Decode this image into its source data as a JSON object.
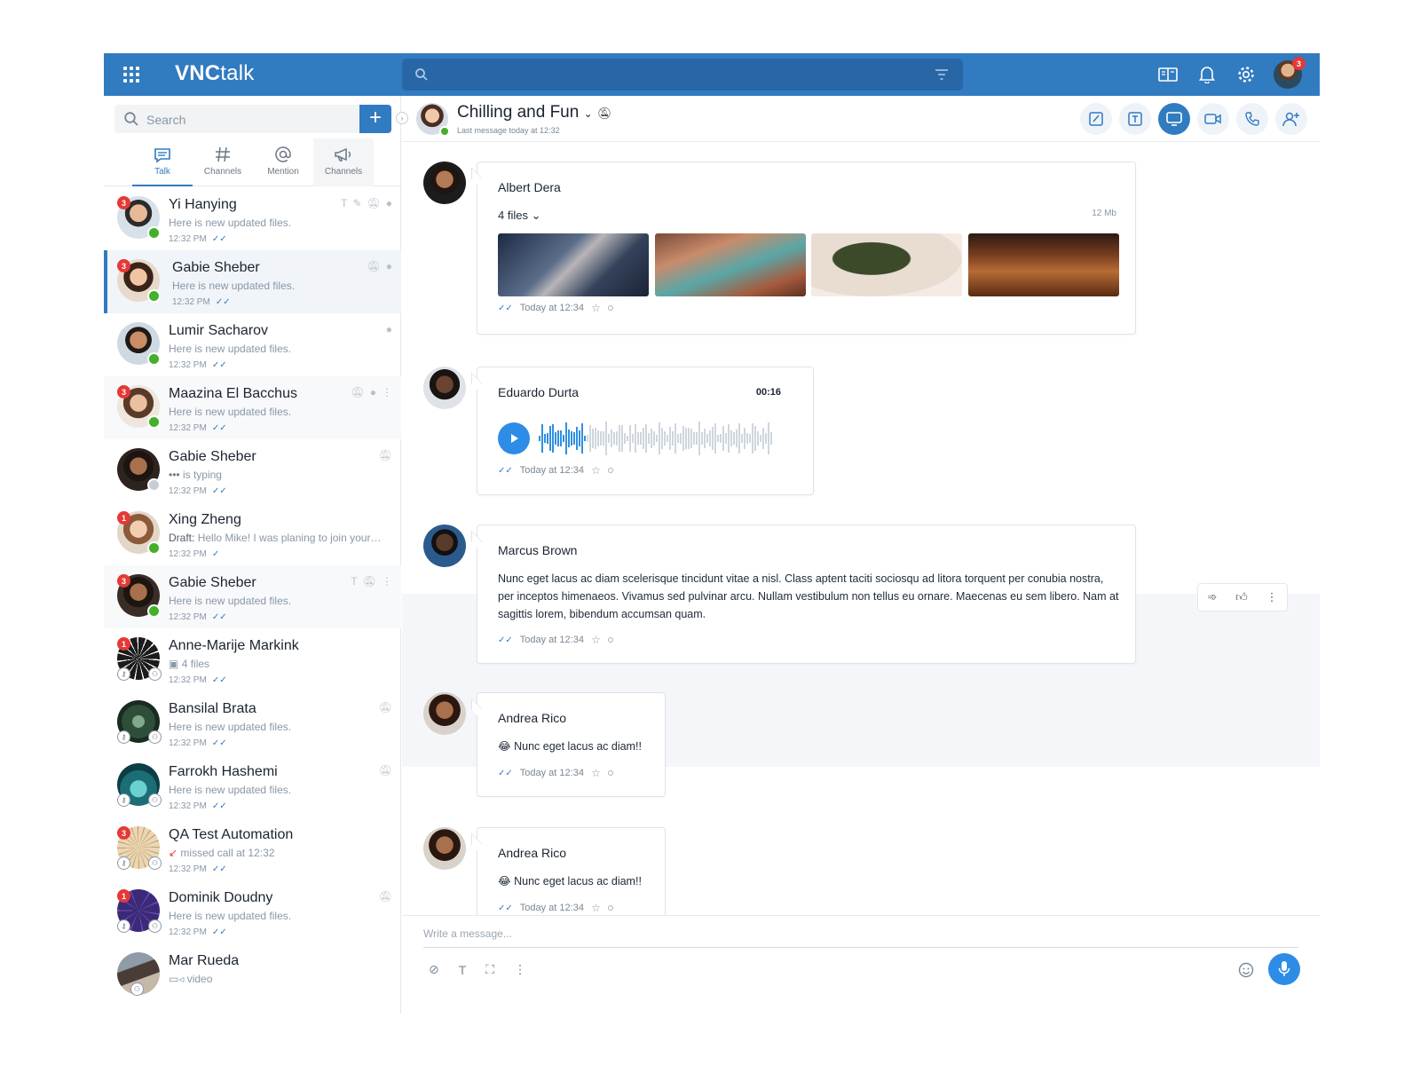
{
  "app": {
    "logo_bold": "VNC",
    "logo_light": "talk"
  },
  "topbar": {
    "notification_count": "3"
  },
  "sidebar": {
    "search_placeholder": "Search",
    "add_label": "+",
    "tabs": [
      {
        "label": "Talk",
        "icon": "chat-icon"
      },
      {
        "label": "Channels",
        "icon": "hash-icon"
      },
      {
        "label": "Mention",
        "icon": "at-icon"
      },
      {
        "label": "Channels",
        "icon": "megaphone-icon"
      }
    ],
    "conversations": [
      {
        "name": "Yi Hanying",
        "preview": "Here is new updated files.",
        "time": "12:32 PM",
        "unread": "3"
      },
      {
        "name": "Gabie Sheber",
        "preview": "Here is new updated files.",
        "time": "12:32 PM",
        "unread": "3"
      },
      {
        "name": "Lumir Sacharov",
        "preview": "Here is new updated files.",
        "time": "12:32 PM",
        "unread": ""
      },
      {
        "name": "Maazina El Bacchus",
        "preview": "Here is new updated files.",
        "time": "12:32 PM",
        "unread": "3"
      },
      {
        "name": "Gabie Sheber",
        "preview": "is typing",
        "time": "12:32 PM",
        "unread": ""
      },
      {
        "name": "Xing Zheng",
        "preview_prefix": "Draft:",
        "preview": "Hello Mike! I was planing to join your…",
        "time": "12:32 PM",
        "unread": "1"
      },
      {
        "name": "Gabie Sheber",
        "preview": "Here is new updated files.",
        "time": "12:32 PM",
        "unread": "3"
      },
      {
        "name": "Anne-Marije Markink",
        "preview": "4 files",
        "time": "12:32 PM",
        "unread": "1"
      },
      {
        "name": "Bansilal Brata",
        "preview": "Here is new updated files.",
        "time": "12:32 PM",
        "unread": ""
      },
      {
        "name": "Farrokh Hashemi",
        "preview": "Here is new updated files.",
        "time": "12:32 PM",
        "unread": ""
      },
      {
        "name": "QA Test Automation",
        "preview": "missed call at 12:32",
        "time": "12:32 PM",
        "unread": "3"
      },
      {
        "name": "Dominik Doudny",
        "preview": "Here is new updated files.",
        "time": "12:32 PM",
        "unread": "1"
      },
      {
        "name": "Mar Rueda",
        "preview": "video",
        "time": "",
        "unread": ""
      }
    ]
  },
  "chat": {
    "title": "Chilling and Fun",
    "subtitle": "Last message today at 12:32",
    "messages": [
      {
        "sender": "Albert Dera",
        "files_label": "4 files",
        "files_size": "12 Mb",
        "time": "Today at 12:34"
      },
      {
        "sender": "Eduardo Durta",
        "duration": "00:16",
        "time": "Today at 12:34"
      },
      {
        "sender": "Marcus Brown",
        "text": "Nunc eget lacus ac diam scelerisque tincidunt vitae a nisl. Class aptent taciti sociosqu ad litora torquent per conubia nostra, per inceptos himenaeos. Vivamus sed pulvinar arcu. Nullam vestibulum non tellus eu ornare. Maecenas eu sem libero. Nam at sagittis lorem, bibendum accumsan quam.",
        "time": "Today at 12:34"
      },
      {
        "sender": "Andrea Rico",
        "text": "Nunc eget lacus ac diam!!",
        "emoji": "😂",
        "time": "Today at 12:34"
      },
      {
        "sender": "Andrea Rico",
        "text": "Nunc eget lacus ac diam!!",
        "emoji": "😂",
        "time": "Today at 12:34"
      }
    ],
    "composer_placeholder": "Write a message..."
  },
  "colors": {
    "brand": "#317bc1",
    "online": "#43b02a",
    "badge": "#e53935",
    "accent": "#2d8ce6"
  }
}
